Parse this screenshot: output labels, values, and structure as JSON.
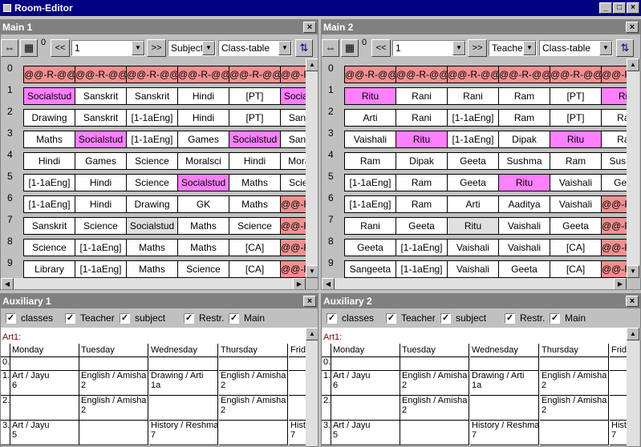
{
  "window": {
    "title": "Room-Editor"
  },
  "main_panes": [
    {
      "title": "Main 1",
      "zero_label": "0",
      "select_value": "1",
      "mode_value": "Subject",
      "view_value": "Class-table",
      "rows": [
        {
          "num": "0",
          "cells": [
            {
              "t": "@@-R-@@",
              "s": "red"
            },
            {
              "t": "@@-R-@@",
              "s": "red"
            },
            {
              "t": "@@-R-@@",
              "s": "red"
            },
            {
              "t": "@@-R-@@",
              "s": "red"
            },
            {
              "t": "@@-R-@@",
              "s": "red"
            },
            {
              "t": "@@-R-@@",
              "s": "red"
            }
          ]
        },
        {
          "num": "1",
          "cells": [
            {
              "t": "Socialstud",
              "s": "pink"
            },
            {
              "t": "Sanskrit",
              "s": ""
            },
            {
              "t": "Sanskrit",
              "s": ""
            },
            {
              "t": "Hindi",
              "s": ""
            },
            {
              "t": "[PT]",
              "s": ""
            },
            {
              "t": "Socialstud",
              "s": "pink"
            }
          ]
        },
        {
          "num": "2",
          "cells": [
            {
              "t": "Drawing",
              "s": ""
            },
            {
              "t": "Sanskrit",
              "s": ""
            },
            {
              "t": "[1-1aEng]",
              "s": ""
            },
            {
              "t": "Hindi",
              "s": ""
            },
            {
              "t": "[PT]",
              "s": ""
            },
            {
              "t": "Sanskrit",
              "s": ""
            }
          ]
        },
        {
          "num": "3",
          "cells": [
            {
              "t": "Maths",
              "s": ""
            },
            {
              "t": "Socialstud",
              "s": "pink"
            },
            {
              "t": "[1-1aEng]",
              "s": ""
            },
            {
              "t": "Games",
              "s": ""
            },
            {
              "t": "Socialstud",
              "s": "pink"
            },
            {
              "t": "Sanskrit",
              "s": ""
            }
          ]
        },
        {
          "num": "4",
          "cells": [
            {
              "t": "Hindi",
              "s": ""
            },
            {
              "t": "Games",
              "s": ""
            },
            {
              "t": "Science",
              "s": ""
            },
            {
              "t": "Moralsci",
              "s": ""
            },
            {
              "t": "Hindi",
              "s": ""
            },
            {
              "t": "Moralsci",
              "s": ""
            }
          ]
        },
        {
          "num": "5",
          "cells": [
            {
              "t": "[1-1aEng]",
              "s": ""
            },
            {
              "t": "Hindi",
              "s": ""
            },
            {
              "t": "Science",
              "s": ""
            },
            {
              "t": "Socialstud",
              "s": "pink"
            },
            {
              "t": "Maths",
              "s": ""
            },
            {
              "t": "Science",
              "s": ""
            }
          ]
        },
        {
          "num": "6",
          "cells": [
            {
              "t": "[1-1aEng]",
              "s": ""
            },
            {
              "t": "Hindi",
              "s": ""
            },
            {
              "t": "Drawing",
              "s": ""
            },
            {
              "t": "GK",
              "s": ""
            },
            {
              "t": "Maths",
              "s": ""
            },
            {
              "t": "@@-R-@@",
              "s": "red"
            }
          ]
        },
        {
          "num": "7",
          "cells": [
            {
              "t": "Sanskrit",
              "s": ""
            },
            {
              "t": "Science",
              "s": ""
            },
            {
              "t": "Socialstud",
              "s": "gray"
            },
            {
              "t": "Maths",
              "s": ""
            },
            {
              "t": "Science",
              "s": ""
            },
            {
              "t": "@@-R-@@",
              "s": "red"
            }
          ]
        },
        {
          "num": "8",
          "cells": [
            {
              "t": "Science",
              "s": ""
            },
            {
              "t": "[1-1aEng]",
              "s": ""
            },
            {
              "t": "Maths",
              "s": ""
            },
            {
              "t": "Maths",
              "s": ""
            },
            {
              "t": "[CA]",
              "s": ""
            },
            {
              "t": "@@-R-@@",
              "s": "red"
            }
          ]
        },
        {
          "num": "9",
          "cells": [
            {
              "t": "Library",
              "s": ""
            },
            {
              "t": "[1-1aEng]",
              "s": ""
            },
            {
              "t": "Maths",
              "s": ""
            },
            {
              "t": "Science",
              "s": ""
            },
            {
              "t": "[CA]",
              "s": ""
            },
            {
              "t": "@@-R-@@",
              "s": "red"
            }
          ]
        }
      ]
    },
    {
      "title": "Main 2",
      "zero_label": "0",
      "select_value": "1",
      "mode_value": "Teacher",
      "view_value": "Class-table",
      "rows": [
        {
          "num": "0",
          "cells": [
            {
              "t": "@@-R-@@",
              "s": "red"
            },
            {
              "t": "@@-R-@@",
              "s": "red"
            },
            {
              "t": "@@-R-@@",
              "s": "red"
            },
            {
              "t": "@@-R-@@",
              "s": "red"
            },
            {
              "t": "@@-R-@@",
              "s": "red"
            },
            {
              "t": "@@-R-@@",
              "s": "red"
            }
          ]
        },
        {
          "num": "1",
          "cells": [
            {
              "t": "Ritu",
              "s": "pink"
            },
            {
              "t": "Rani",
              "s": ""
            },
            {
              "t": "Rani",
              "s": ""
            },
            {
              "t": "Ram",
              "s": ""
            },
            {
              "t": "[PT]",
              "s": ""
            },
            {
              "t": "Ritu",
              "s": "pink"
            }
          ]
        },
        {
          "num": "2",
          "cells": [
            {
              "t": "Arti",
              "s": ""
            },
            {
              "t": "Rani",
              "s": ""
            },
            {
              "t": "[1-1aEng]",
              "s": ""
            },
            {
              "t": "Ram",
              "s": ""
            },
            {
              "t": "[PT]",
              "s": ""
            },
            {
              "t": "Rani",
              "s": ""
            }
          ]
        },
        {
          "num": "3",
          "cells": [
            {
              "t": "Vaishali",
              "s": ""
            },
            {
              "t": "Ritu",
              "s": "pink"
            },
            {
              "t": "[1-1aEng]",
              "s": ""
            },
            {
              "t": "Dipak",
              "s": ""
            },
            {
              "t": "Ritu",
              "s": "pink"
            },
            {
              "t": "Rani",
              "s": ""
            }
          ]
        },
        {
          "num": "4",
          "cells": [
            {
              "t": "Ram",
              "s": ""
            },
            {
              "t": "Dipak",
              "s": ""
            },
            {
              "t": "Geeta",
              "s": ""
            },
            {
              "t": "Sushma",
              "s": ""
            },
            {
              "t": "Ram",
              "s": ""
            },
            {
              "t": "Sushma",
              "s": ""
            }
          ]
        },
        {
          "num": "5",
          "cells": [
            {
              "t": "[1-1aEng]",
              "s": ""
            },
            {
              "t": "Ram",
              "s": ""
            },
            {
              "t": "Geeta",
              "s": ""
            },
            {
              "t": "Ritu",
              "s": "pink"
            },
            {
              "t": "Vaishali",
              "s": ""
            },
            {
              "t": "Geeta",
              "s": ""
            }
          ]
        },
        {
          "num": "6",
          "cells": [
            {
              "t": "[1-1aEng]",
              "s": ""
            },
            {
              "t": "Ram",
              "s": ""
            },
            {
              "t": "Arti",
              "s": ""
            },
            {
              "t": "Aaditya",
              "s": ""
            },
            {
              "t": "Vaishali",
              "s": ""
            },
            {
              "t": "@@-R-@@",
              "s": "red"
            }
          ]
        },
        {
          "num": "7",
          "cells": [
            {
              "t": "Rani",
              "s": ""
            },
            {
              "t": "Geeta",
              "s": ""
            },
            {
              "t": "Ritu",
              "s": "gray"
            },
            {
              "t": "Vaishali",
              "s": ""
            },
            {
              "t": "Geeta",
              "s": ""
            },
            {
              "t": "@@-R-@@",
              "s": "red"
            }
          ]
        },
        {
          "num": "8",
          "cells": [
            {
              "t": "Geeta",
              "s": ""
            },
            {
              "t": "[1-1aEng]",
              "s": ""
            },
            {
              "t": "Vaishali",
              "s": ""
            },
            {
              "t": "Vaishali",
              "s": ""
            },
            {
              "t": "[CA]",
              "s": ""
            },
            {
              "t": "@@-R-@@",
              "s": "red"
            }
          ]
        },
        {
          "num": "9",
          "cells": [
            {
              "t": "Sangeeta",
              "s": ""
            },
            {
              "t": "[1-1aEng]",
              "s": ""
            },
            {
              "t": "Vaishali",
              "s": ""
            },
            {
              "t": "Geeta",
              "s": ""
            },
            {
              "t": "[CA]",
              "s": ""
            },
            {
              "t": "@@-R-@@",
              "s": "red"
            }
          ]
        }
      ]
    }
  ],
  "aux_panes": [
    {
      "title": "Auxiliary 1",
      "checks": [
        "classes",
        "Teacher",
        "subject",
        "Restr.",
        "Main"
      ],
      "label": "Art1:",
      "days": [
        "Monday",
        "Tuesday",
        "Wednesday",
        "Thursday",
        "Friday"
      ],
      "rows": [
        {
          "num": "0.",
          "cells": [
            [
              "",
              ""
            ],
            [
              "",
              ""
            ],
            [
              "",
              ""
            ],
            [
              "",
              ""
            ],
            [
              "",
              ""
            ]
          ]
        },
        {
          "num": "1.",
          "cells": [
            [
              "Art / Jayu",
              "6"
            ],
            [
              "English / Amisha",
              "2"
            ],
            [
              "Drawing / Arti",
              "1a"
            ],
            [
              "English / Amisha",
              "2"
            ],
            [
              "",
              ""
            ]
          ]
        },
        {
          "num": "2.",
          "cells": [
            [
              "",
              ""
            ],
            [
              "English / Amisha",
              "2"
            ],
            [
              "",
              ""
            ],
            [
              "English / Amisha",
              "2"
            ],
            [
              "",
              ""
            ]
          ]
        },
        {
          "num": "3.",
          "cells": [
            [
              "Art / Jayu",
              "5"
            ],
            [
              "",
              ""
            ],
            [
              "History / Reshma",
              "7"
            ],
            [
              "",
              ""
            ],
            [
              "History / Reshma",
              "7"
            ]
          ]
        }
      ]
    },
    {
      "title": "Auxiliary 2",
      "checks": [
        "classes",
        "Teacher",
        "subject",
        "Restr.",
        "Main"
      ],
      "label": "Art1:",
      "days": [
        "Monday",
        "Tuesday",
        "Wednesday",
        "Thursday",
        "Friday"
      ],
      "rows": [
        {
          "num": "0.",
          "cells": [
            [
              "",
              ""
            ],
            [
              "",
              ""
            ],
            [
              "",
              ""
            ],
            [
              "",
              ""
            ],
            [
              "",
              ""
            ]
          ]
        },
        {
          "num": "1.",
          "cells": [
            [
              "Art / Jayu",
              "6"
            ],
            [
              "English / Amisha",
              "2"
            ],
            [
              "Drawing / Arti",
              "1a"
            ],
            [
              "English / Amisha",
              "2"
            ],
            [
              "",
              ""
            ]
          ]
        },
        {
          "num": "2.",
          "cells": [
            [
              "",
              ""
            ],
            [
              "English / Amisha",
              "2"
            ],
            [
              "",
              ""
            ],
            [
              "English / Amisha",
              "2"
            ],
            [
              "",
              ""
            ]
          ]
        },
        {
          "num": "3.",
          "cells": [
            [
              "Art / Jayu",
              "5"
            ],
            [
              "",
              ""
            ],
            [
              "History / Reshma",
              "7"
            ],
            [
              "",
              ""
            ],
            [
              "History / Reshma",
              "7"
            ]
          ]
        }
      ]
    }
  ],
  "icons": {
    "close": "×",
    "minimize": "_",
    "maximize": "□",
    "nav_left": "<<",
    "nav_right": ">>",
    "dropdown": "▼",
    "check": "✓"
  }
}
